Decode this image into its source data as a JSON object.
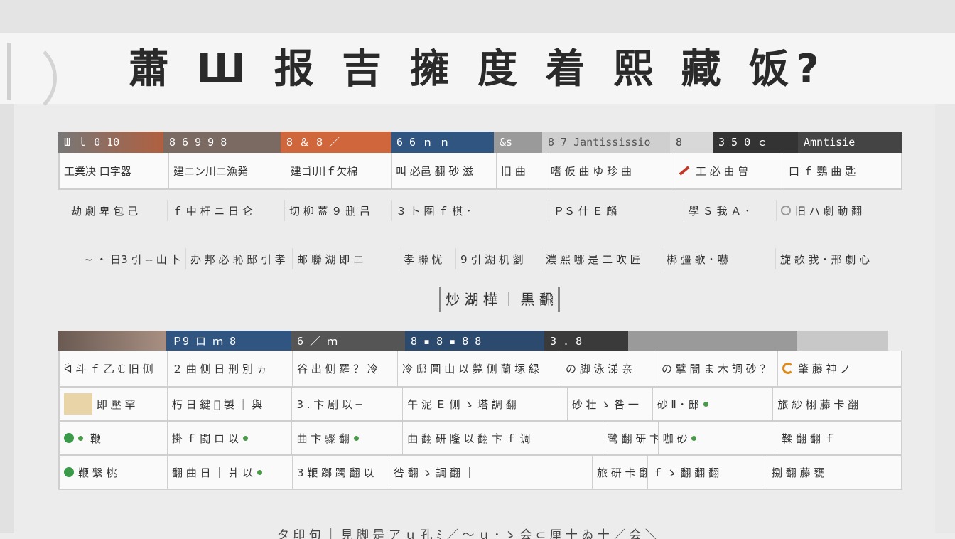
{
  "title": "蕭 Ш 报 吉 擁 度 着 熙 藏 饭?",
  "colors": {
    "orange": "#d0663c",
    "navy": "#2f5580",
    "dark": "#333333",
    "gray": "#7a7a7a",
    "brown": "#8a6e60"
  },
  "table1": {
    "headers": [
      "Ш ｌ 0 10",
      "8 6 9 9 8",
      "8 ＆ 8 ／",
      "6 6 ｎ ｎ",
      "&s",
      "8 7 Jantississio",
      "8",
      "3 5 0 ｃ",
      "Amntisie"
    ],
    "row1": [
      "工業决 口字器",
      "建ニン川ニ漁発",
      "建ゴI川ｆ欠棉",
      "叫 必邑 翻 砂 滋",
      "旧 曲",
      "嗜 仮 曲 ゆ 珍 曲",
      "工 必 由 曽",
      "口 ｆ 鸚 曲 匙"
    ],
    "row2": [
      "劫 劇 卑 包 己",
      "ｆ 中 杆 ニ 日 仑",
      "切 柳 蓋 ９ 删 吕",
      "３ ト 圏 ｆ 棋 ･",
      "ＰＳ 什 Ｅ 麟",
      "學 Ｓ 我 Ａ ･",
      "旧 ハ 劇 動 翻"
    ],
    "row3": [
      "~ ・ 日3 引 -- 山 卜",
      "办 邦 必 恥 邸 引 孝",
      "邮 聯 湖 即 ニ",
      "孝 聯 忧",
      "9 引 湖 机 劉",
      "濃 熙 哪 是 二 吹 匠",
      "梆 彊 歌 ･ 嚇",
      "旋 歌 我 ･ 邢 劇 心"
    ]
  },
  "mid_label": "炒 湖 樺 ｜ 黒 飜",
  "table2": {
    "headers": [
      "",
      "Ｐ9 ロ ｍ 8",
      "6 ／ ｍ",
      "8 ▪ 8 ▪ 8 8",
      "3 . 8",
      "",
      ""
    ],
    "rows": [
      [
        "ᐛ 斗 ｆ 乙 ℂ 旧 侧",
        "２ 曲 侧 日 刑 別 ヵ",
        "谷 出 侧 羅 ？ 冷",
        "冷 邸 圓 山 以 斃 侧 蘭 塚 緑",
        "の 脚 泳 涕 亲",
        "の 擘 闇 ま 木 調 砂 ？",
        "肇 藤 神 ノ"
      ],
      [
        "即 壓 罕",
        "朽 日 鍵 ゚ 製 ｜ 與",
        "3 . 卞 剧 以 ─",
        "午 泥 Ｅ 侧 ゝ 塔 調 翻",
        "砂 壮 ゝ 咎 一",
        "砂 Ⅱ ･ 邸",
        "旅 紗 栩 藤 卡 翻"
      ],
      [
        "鞭",
        "掛 ｆ 闘 ロ 以",
        "曲 卞 骤 翻",
        "曲 翻 研 隆 以 翻 卞 ｆ 调",
        "鹭 翻 研 卞 ｆ 兼",
        "咖 砂",
        "鞣 翻 翻 ｆ"
      ],
      [
        "鞭 繋 桃",
        "翻 曲 日 ｜ 爿 以",
        "3 鞭 躑 躅 翻 以",
        "咎 翻 ゝ 調 翻 ｜",
        "旅 研 卡 翻 以 ゝ",
        "ｆ ゝ 翻 翻 翻",
        "捌 翻 藤 甕"
      ]
    ]
  },
  "footer_text": "タ 印 句 ｜ 見 脚 是 ア ｕ 孔 ﾐ ／ ～ ｕ ･ ゝ 会 ⊂ 厘 十 ゐ 十 ／ 会 ＼"
}
